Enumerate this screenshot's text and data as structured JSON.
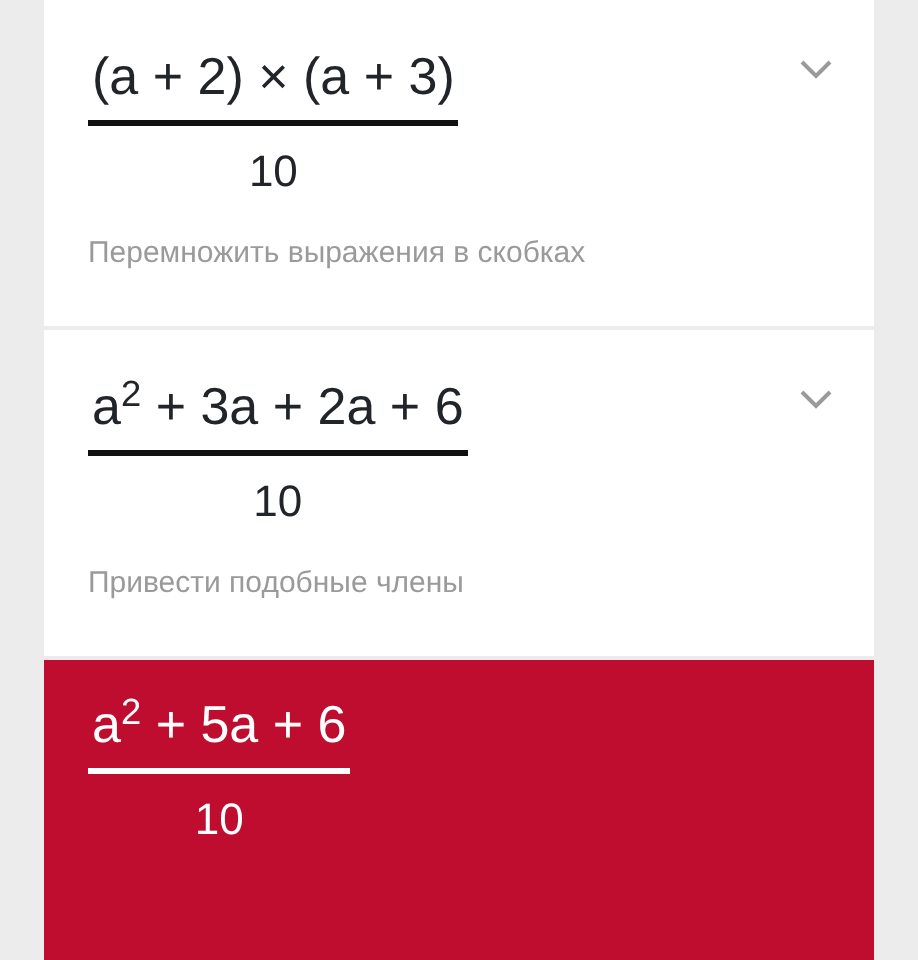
{
  "steps": [
    {
      "kind": "step",
      "numerator": "(a + 2) × (a + 3)",
      "denominator": "10",
      "description": "Перемножить выражения в скобках",
      "expanded": false
    },
    {
      "kind": "step",
      "numerator": "a$^{2}$ + 3a + 2a + 6",
      "denominator": "10",
      "description": "Привести подобные члены",
      "expanded": false
    },
    {
      "kind": "result",
      "numerator": "a$^{2}$ + 5a + 6",
      "denominator": "10"
    }
  ]
}
